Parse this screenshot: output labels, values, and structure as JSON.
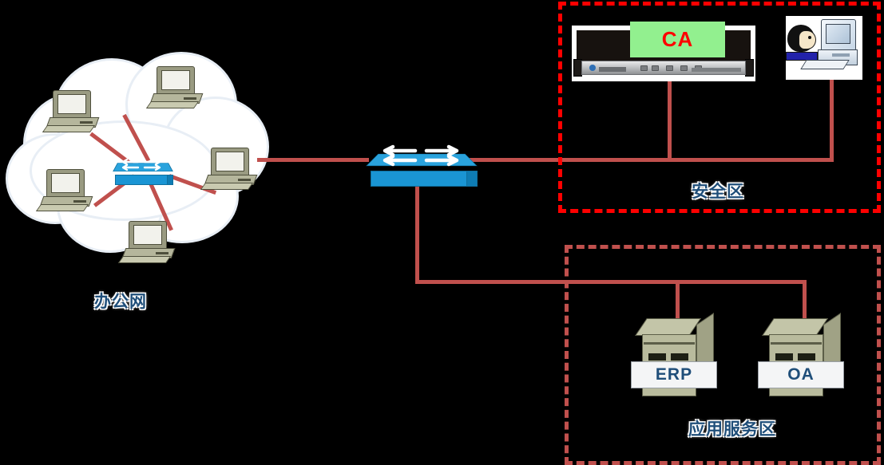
{
  "diagram": {
    "title": "Network Topology",
    "background_color": "#000000",
    "link_color": "#c0504d",
    "label_color": "#1f4e79"
  },
  "office_cloud": {
    "caption": "办公网",
    "icon": "cloud-icon",
    "core_device": {
      "name": "office-switch",
      "icon": "network-switch-icon",
      "color": "#2aa3dd"
    },
    "hosts": [
      {
        "name": "office-pc-1",
        "icon": "desktop-pc-icon"
      },
      {
        "name": "office-pc-2",
        "icon": "desktop-pc-icon"
      },
      {
        "name": "office-pc-3",
        "icon": "desktop-pc-icon"
      },
      {
        "name": "office-pc-4",
        "icon": "desktop-pc-icon"
      },
      {
        "name": "office-pc-5",
        "icon": "desktop-pc-icon"
      }
    ]
  },
  "core_switch": {
    "name": "core-switch",
    "icon": "network-switch-icon",
    "color": "#2aa3dd"
  },
  "secure_zone": {
    "caption": "安全区",
    "border_color": "#ff0000",
    "border_style": "dashed",
    "devices": [
      {
        "name": "ca-server",
        "icon": "rack-server-icon",
        "screen_label": "CA",
        "screen_color": "#92f08f",
        "screen_text_color": "#ff0000"
      },
      {
        "name": "operator-workstation",
        "icon": "operator-workstation-icon"
      }
    ]
  },
  "app_zone": {
    "caption": "应用服务区",
    "border_color": "#c0504d",
    "border_style": "dashed",
    "servers": [
      {
        "name": "erp-server",
        "label": "ERP",
        "icon": "server-icon"
      },
      {
        "name": "oa-server",
        "label": "OA",
        "icon": "server-icon"
      }
    ]
  }
}
